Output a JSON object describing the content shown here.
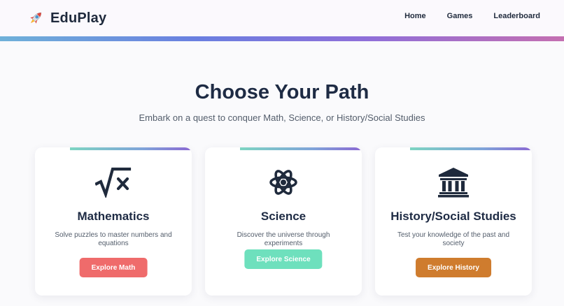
{
  "brand": {
    "name": "EduPlay",
    "icon": "rocket-icon"
  },
  "nav": {
    "items": [
      "Home",
      "Games",
      "Leaderboard"
    ]
  },
  "hero": {
    "title": "Choose Your Path",
    "subtitle": "Embark on a quest to conquer Math, Science, or History/Social Studies"
  },
  "cards": [
    {
      "icon": "square-root-icon",
      "title": "Mathematics",
      "description": "Solve puzzles to master numbers and equations",
      "button": "Explore Math",
      "button_color": "#ef6b6b"
    },
    {
      "icon": "atom-icon",
      "title": "Science",
      "description": "Discover the universe through experiments",
      "button": "Explore Science",
      "button_color": "#6ee0bd"
    },
    {
      "icon": "museum-icon",
      "title": "History/Social Studies",
      "description": "Test your knowledge of the past and society",
      "button": "Explore History",
      "button_color": "#cf7c2e"
    }
  ],
  "colors": {
    "text_dark": "#1e2b44",
    "text_muted": "#535d6b",
    "header_gradient": [
      "#6fb1d9",
      "#6a7fe0",
      "#8f6fd9",
      "#c46fb1"
    ],
    "card_accent_gradient": [
      "#7dd5c2",
      "#7fa3d9",
      "#8a68d2"
    ]
  }
}
